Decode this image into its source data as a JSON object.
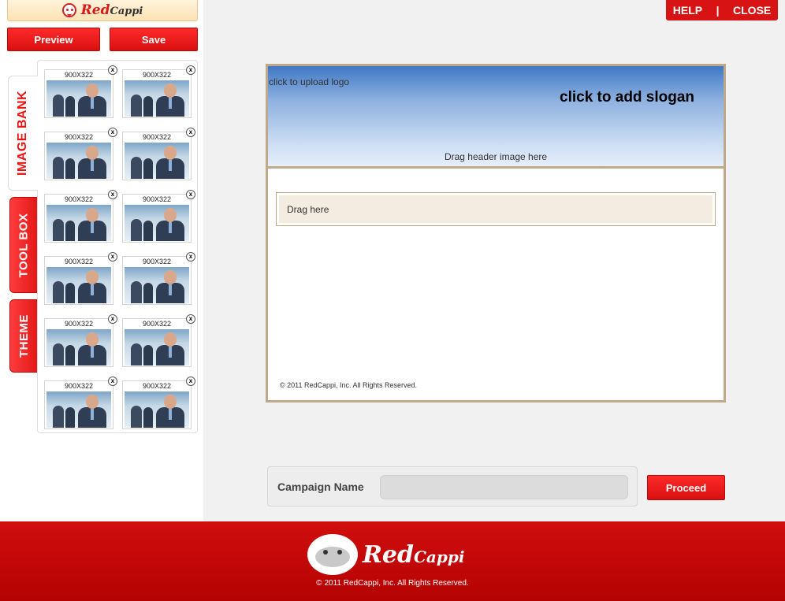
{
  "brand": {
    "logo_red": "Red",
    "logo_dark": "Cappi"
  },
  "toolbar": {
    "preview_label": "Preview",
    "save_label": "Save"
  },
  "top_actions": {
    "help_label": "HELP",
    "separator": "|",
    "close_label": "CLOSE"
  },
  "tabs": {
    "image_bank": "IMAGE BANK",
    "tool_box": "TOOL BOX",
    "theme": "THEME"
  },
  "image_bank": {
    "items": [
      {
        "size": "900X322"
      },
      {
        "size": "900X322"
      },
      {
        "size": "900X322"
      },
      {
        "size": "900X322"
      },
      {
        "size": "900X322"
      },
      {
        "size": "900X322"
      },
      {
        "size": "900X322"
      },
      {
        "size": "900X322"
      },
      {
        "size": "900X322"
      },
      {
        "size": "900X322"
      },
      {
        "size": "900X322"
      },
      {
        "size": "900X322"
      }
    ],
    "remove_label": "x"
  },
  "canvas": {
    "upload_logo": "click to upload logo",
    "slogan": "click to add slogan",
    "drag_header": "Drag header image here",
    "drag_here": "Drag here",
    "footer_text": "© 2011 RedCappi, Inc. All Rights Reserved."
  },
  "campaign": {
    "label": "Campaign Name",
    "value": "",
    "proceed_label": "Proceed"
  },
  "footer": {
    "brand_red": "Red",
    "brand_cappi": "Cappi",
    "copyright": "© 2011 RedCappi, Inc. All Rights Reserved."
  },
  "colors": {
    "accent": "#d71313",
    "canvas_border": "#bfa98a",
    "drop_zone": "#f4ebe1"
  }
}
